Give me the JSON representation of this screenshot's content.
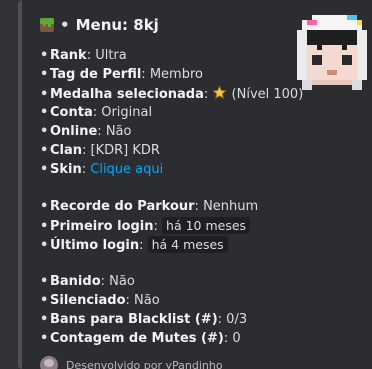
{
  "menu": {
    "title_prefix": "•",
    "title": "Menu: 8kj"
  },
  "profile": {
    "rank_label": "Rank",
    "rank_value": "Ultra",
    "tag_label": "Tag de Perfil",
    "tag_value": "Membro",
    "medal_label": "Medalha selecionada",
    "medal_icon": "star-icon",
    "medal_value": "(Nível 100)",
    "conta_label": "Conta",
    "conta_value": "Original",
    "online_label": "Online",
    "online_value": "Não",
    "clan_label": "Clan",
    "clan_value": "[KDR] KDR",
    "skin_label": "Skin",
    "skin_link": "Clique aqui"
  },
  "stats": {
    "parkour_label": "Recorde do Parkour",
    "parkour_value": "Nenhum",
    "first_login_label": "Primeiro login",
    "first_login_value": "há 10 meses",
    "last_login_label": "Último login",
    "last_login_value": "há 4 meses"
  },
  "moderation": {
    "banned_label": "Banido",
    "banned_value": "Não",
    "muted_label": "Silenciado",
    "muted_value": "Não",
    "blacklist_label": "Bans para Blacklist (#)",
    "blacklist_value": "0/3",
    "mutes_label": "Contagem de Mutes (#)",
    "mutes_value": "0"
  },
  "footer": {
    "text": "Desenvolvido por yPandinho"
  },
  "colors": {
    "accent_link": "#00a8fc",
    "embed_bg": "#2b2d31",
    "page_bg": "#313338"
  }
}
